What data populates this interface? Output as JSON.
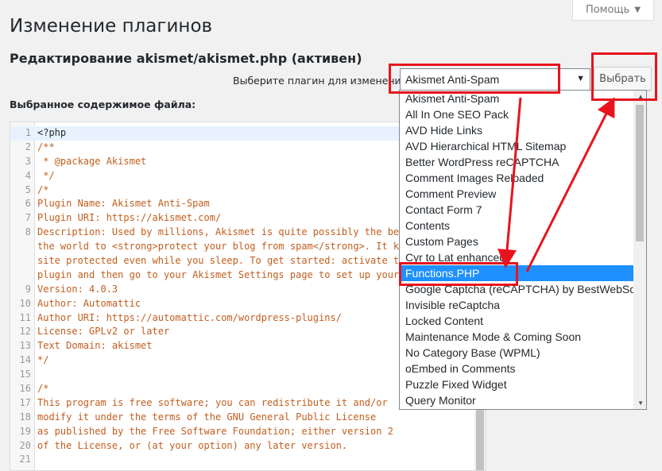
{
  "header": {
    "help_label": "Помощь",
    "page_title": "Изменение плагинов",
    "file_heading": "Редактирование akismet/akismet.php (активен)"
  },
  "plugin_select": {
    "label": "Выберите плагин для изменения:",
    "value": "Akismet Anti-Spam",
    "button_label": "Выбрать"
  },
  "editor": {
    "selected_content_label": "Выбранное содержимое файла:",
    "lines": [
      {
        "n": "1",
        "text": "<?php",
        "style": "plain"
      },
      {
        "n": "2",
        "text": "/**",
        "style": "comment"
      },
      {
        "n": "3",
        "text": " * @package Akismet",
        "style": "comment"
      },
      {
        "n": "4",
        "text": " */",
        "style": "comment"
      },
      {
        "n": "5",
        "text": "/*",
        "style": "comment"
      },
      {
        "n": "6",
        "text": "Plugin Name: Akismet Anti-Spam",
        "style": "comment"
      },
      {
        "n": "7",
        "text": "Plugin URI: https://akismet.com/",
        "style": "comment"
      },
      {
        "n": "8",
        "text": "Description: Used by millions, Akismet is quite possibly the bes",
        "style": "comment"
      },
      {
        "n": "",
        "text": "the world to <strong>protect your blog from spam</strong>. It ke",
        "style": "comment"
      },
      {
        "n": "",
        "text": "site protected even while you sleep. To get started: activate th",
        "style": "comment"
      },
      {
        "n": "",
        "text": "plugin and then go to your Akismet Settings page to set up your",
        "style": "comment"
      },
      {
        "n": "9",
        "text": "Version: 4.0.3",
        "style": "comment"
      },
      {
        "n": "10",
        "text": "Author: Automattic",
        "style": "comment"
      },
      {
        "n": "11",
        "text": "Author URI: https://automattic.com/wordpress-plugins/",
        "style": "comment"
      },
      {
        "n": "12",
        "text": "License: GPLv2 or later",
        "style": "comment"
      },
      {
        "n": "13",
        "text": "Text Domain: akismet",
        "style": "comment"
      },
      {
        "n": "14",
        "text": "*/",
        "style": "comment"
      },
      {
        "n": "15",
        "text": "",
        "style": "comment"
      },
      {
        "n": "16",
        "text": "/*",
        "style": "comment"
      },
      {
        "n": "17",
        "text": "This program is free software; you can redistribute it and/or",
        "style": "comment"
      },
      {
        "n": "18",
        "text": "modify it under the terms of the GNU General Public License",
        "style": "comment"
      },
      {
        "n": "19",
        "text": "as published by the Free Software Foundation; either version 2",
        "style": "comment"
      },
      {
        "n": "20",
        "text": "of the License, or (at your option) any later version.",
        "style": "comment"
      },
      {
        "n": "21",
        "text": "",
        "style": "comment"
      }
    ]
  },
  "dropdown": {
    "selected_index": 11,
    "options": [
      "Akismet Anti-Spam",
      "All In One SEO Pack",
      "AVD Hide Links",
      "AVD Hierarchical HTML Sitemap",
      "Better WordPress reCAPTCHA",
      "Comment Images Reloaded",
      "Comment Preview",
      "Contact Form 7",
      "Contents",
      "Custom Pages",
      "Cyr to Lat enhanced",
      "Functions.PHP",
      "Google Captcha (reCAPTCHA) by BestWebSoft",
      "Invisible reCaptcha",
      "Locked Content",
      "Maintenance Mode & Coming Soon",
      "No Category Base (WPML)",
      "oEmbed in Comments",
      "Puzzle Fixed Widget",
      "Query Monitor"
    ]
  },
  "colors": {
    "annotation_red": "#e8131d",
    "selection_blue": "#1e90ff",
    "comment_orange": "#c25e1e"
  }
}
